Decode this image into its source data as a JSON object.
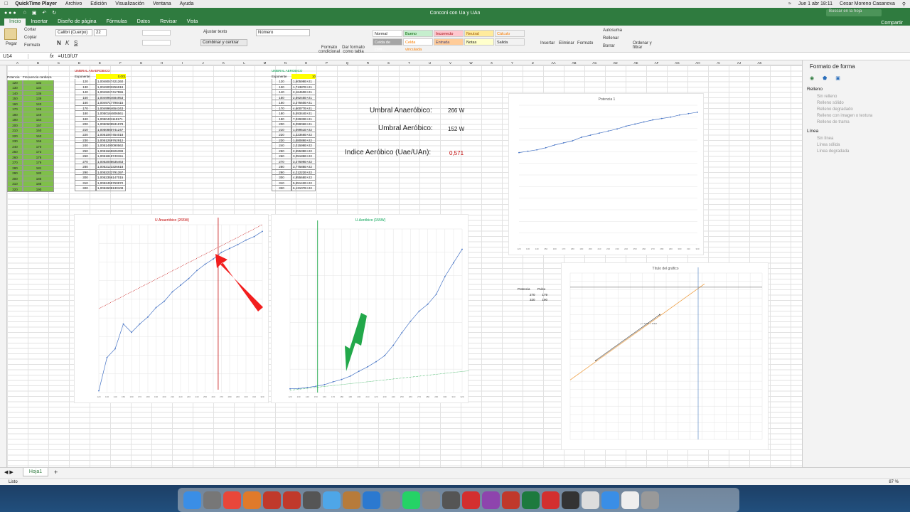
{
  "menubar": {
    "app": "QuickTime Player",
    "items": [
      "Archivo",
      "Edición",
      "Visualización",
      "Ventana",
      "Ayuda"
    ],
    "datetime": "Jue 1 abr 18:11",
    "user": "Cesar Moreno Casanova"
  },
  "window": {
    "title": "Conconi con Ua y UAn",
    "search_placeholder": "Buscar en la hoja",
    "share": "Compartir"
  },
  "tabs": [
    "Inicio",
    "Insertar",
    "Diseño de página",
    "Fórmulas",
    "Datos",
    "Revisar",
    "Vista"
  ],
  "ribbon": {
    "paste": "Pegar",
    "cut": "Cortar",
    "copy": "Copiar",
    "format": "Formato",
    "font": "Calibri (Cuerpo)",
    "font_size": "22",
    "wrap": "Ajustar texto",
    "merge": "Combinar y centrar",
    "number_format": "Número",
    "cond_format": "Formato condicional",
    "table_format": "Dar formato como tabla",
    "styles": [
      "Normal",
      "Bueno",
      "Incorrecto",
      "Neutral",
      "Cálculo",
      "Celda de com...",
      "Celda vinculada",
      "Entrada",
      "Notas",
      "Salida"
    ],
    "insert": "Insertar",
    "delete": "Eliminar",
    "format_btn": "Formato",
    "autosum": "Autosuma",
    "fill": "Rellenar",
    "clear": "Borrar",
    "sort": "Ordenar y filtrar"
  },
  "formula": {
    "namebox": "U14",
    "content": "=U10/U7"
  },
  "columns": [
    "A",
    "B",
    "C",
    "D",
    "E",
    "F",
    "G",
    "H",
    "I",
    "J",
    "K",
    "L",
    "M",
    "N",
    "O",
    "P",
    "Q",
    "R",
    "S",
    "T",
    "U",
    "V",
    "W",
    "X",
    "Y",
    "Z",
    "AA",
    "AB",
    "AC",
    "AD",
    "AE",
    "AF",
    "AG",
    "AH",
    "AI",
    "AJ",
    "AK"
  ],
  "table1": {
    "headers": [
      "Potencia",
      "Frecuencia cardiaca"
    ],
    "potencia": [
      "120",
      "130",
      "140",
      "150",
      "160",
      "170",
      "180",
      "190",
      "200",
      "210",
      "220",
      "230",
      "240",
      "250",
      "260",
      "270",
      "280",
      "290",
      "300",
      "310",
      "320"
    ],
    "fc": [
      "132",
      "134",
      "136",
      "139",
      "143",
      "146",
      "149",
      "154",
      "157",
      "160",
      "163",
      "166",
      "170",
      "173",
      "176",
      "179",
      "181",
      "183",
      "186",
      "188",
      "190"
    ]
  },
  "table2": {
    "title": "UMBRAL ANAEROBICO",
    "exp_label": "Exponente",
    "exp_value": "0,001",
    "x": [
      "120",
      "130",
      "140",
      "150",
      "160",
      "170",
      "180",
      "190",
      "200",
      "210",
      "220",
      "230",
      "240",
      "250",
      "260",
      "270",
      "280",
      "290",
      "300",
      "310",
      "320"
    ],
    "y": [
      "1,0048047421260",
      "1,0049003256919",
      "1,0049247417555",
      "1,0049964684953",
      "1,0049717798415",
      "1,0049964654343",
      "1,0050164806561",
      "1,0050431118171",
      "1,0050609531878",
      "1,0050880741247",
      "1,0051067454018",
      "1,0051259762912",
      "1,0051490090562",
      "1,0051665926399",
      "1,0051818740151",
      "1,0052008635463",
      "1,0052123326618",
      "1,0052232791397",
      "1,0052356147015",
      "1,0052455760872",
      "1,0052608130108"
    ]
  },
  "table3": {
    "title": "UMBRAL AEROBICO",
    "exp_label": "Exponente",
    "exp_value": "10",
    "x": [
      "120",
      "130",
      "140",
      "150",
      "160",
      "170",
      "180",
      "190",
      "200",
      "210",
      "220",
      "230",
      "240",
      "250",
      "260",
      "270",
      "280",
      "290",
      "300",
      "310",
      "320"
    ],
    "y": [
      "1,60599E+21",
      "1,71387E+21",
      "2,16460E+21",
      "2,69245E+21",
      "3,37560E+21",
      "4,60077E+21",
      "5,59344E+21",
      "7,02933E+21",
      "9,09906E+21",
      "1,09951E+22",
      "1,32366E+22",
      "1,58089E+22",
      "2,01599E+22",
      "2,55538E+22",
      "3,05185E+22",
      "3,47699E+22",
      "3,77588E+22",
      "4,21222E+22",
      "4,95568E+22",
      "5,55142E+22",
      "6,13107E+22"
    ]
  },
  "summary": {
    "anaerobic_label": "Umbral Anaeróbico:",
    "anaerobic_value": "266 W",
    "aerobic_label": "Umbral Aeróbico:",
    "aerobic_value": "152 W",
    "index_label": "Indice Aeróbico (Uae/UAn):",
    "index_value": "0,571"
  },
  "mini_table": {
    "headers": [
      "Potencia",
      "Pulso"
    ],
    "rows": [
      [
        "270",
        "179"
      ],
      [
        "320",
        "190"
      ]
    ]
  },
  "chart_data": [
    {
      "type": "line",
      "title": "U.Anaeróbico (265W)",
      "x": [
        120,
        130,
        140,
        150,
        160,
        170,
        180,
        190,
        200,
        210,
        220,
        230,
        240,
        250,
        260,
        270,
        280,
        290,
        300,
        310,
        320
      ],
      "series": [
        {
          "values": [
            1.004805,
            1.0049,
            1.004925,
            1.004996,
            1.004972,
            1.004996,
            1.005016,
            1.005043,
            1.005061,
            1.005088,
            1.005107,
            1.005126,
            1.005149,
            1.005167,
            1.005182,
            1.005201,
            1.005212,
            1.005223,
            1.005236,
            1.005246,
            1.005261
          ]
        }
      ],
      "ylim": [
        1.0048,
        1.00528
      ],
      "annotation_x": 266
    },
    {
      "type": "line",
      "title": "U.Aeróbico (155W)",
      "x": [
        120,
        130,
        140,
        150,
        160,
        170,
        180,
        190,
        200,
        210,
        220,
        230,
        240,
        250,
        260,
        270,
        280,
        290,
        300,
        310,
        320
      ],
      "series": [
        {
          "values": [
            1.6e+21,
            1.71e+21,
            2.16e+21,
            2.69e+21,
            3.38e+21,
            4.6e+21,
            5.59e+21,
            7.03e+21,
            9.1e+21,
            1.1e+22,
            1.32e+22,
            1.58e+22,
            2.02e+22,
            2.56e+22,
            3.05e+22,
            3.48e+22,
            3.78e+22,
            4.21e+22,
            4.96e+22,
            5.55e+22,
            6.13e+22
          ]
        }
      ],
      "ylim": [
        0,
        7e+22
      ],
      "annotation_x": 152
    },
    {
      "type": "line",
      "title": "Potencia 1",
      "x": [
        120,
        130,
        140,
        150,
        160,
        170,
        180,
        190,
        200,
        210,
        220,
        230,
        240,
        250,
        260,
        270,
        280,
        290,
        300,
        310,
        320
      ],
      "series": [
        {
          "values": [
            132,
            134,
            136,
            139,
            143,
            146,
            149,
            154,
            157,
            160,
            163,
            166,
            170,
            173,
            176,
            179,
            181,
            183,
            186,
            188,
            190
          ]
        }
      ],
      "ylim": [
        0,
        200
      ]
    },
    {
      "type": "line",
      "title": "Título del gráfico",
      "annotation": "y = 0,22x + 119,6",
      "x": [
        270,
        320
      ],
      "series": [
        {
          "values": [
            179,
            190
          ]
        }
      ],
      "xlim": [
        250,
        400
      ],
      "ylim": [
        160,
        200
      ]
    }
  ],
  "panel": {
    "title": "Formato de forma",
    "fill_section": "Relleno",
    "fill_options": [
      "Sin relleno",
      "Relleno sólido",
      "Relleno degradado",
      "Relleno con imagen o textura",
      "Relleno de trama"
    ],
    "line_section": "Línea",
    "line_options": [
      "Sin línea",
      "Línea sólida",
      "Línea degradada"
    ]
  },
  "sheet": {
    "tab": "Hoja1",
    "status": "Listo",
    "zoom": "87 %"
  },
  "dock": [
    "Finder",
    "Preview",
    "Chrome",
    "Photos",
    "WKO",
    "WKO5",
    "Rocket",
    "Maps",
    "Archive",
    "Outlook",
    "Settings",
    "WhatsApp",
    "Calc",
    "Scanner",
    "Acrobat",
    "Podcasts",
    "Transfer",
    "Excel",
    "Cast",
    "Activity",
    "Files",
    "Globe",
    "Docs",
    "Trash"
  ]
}
